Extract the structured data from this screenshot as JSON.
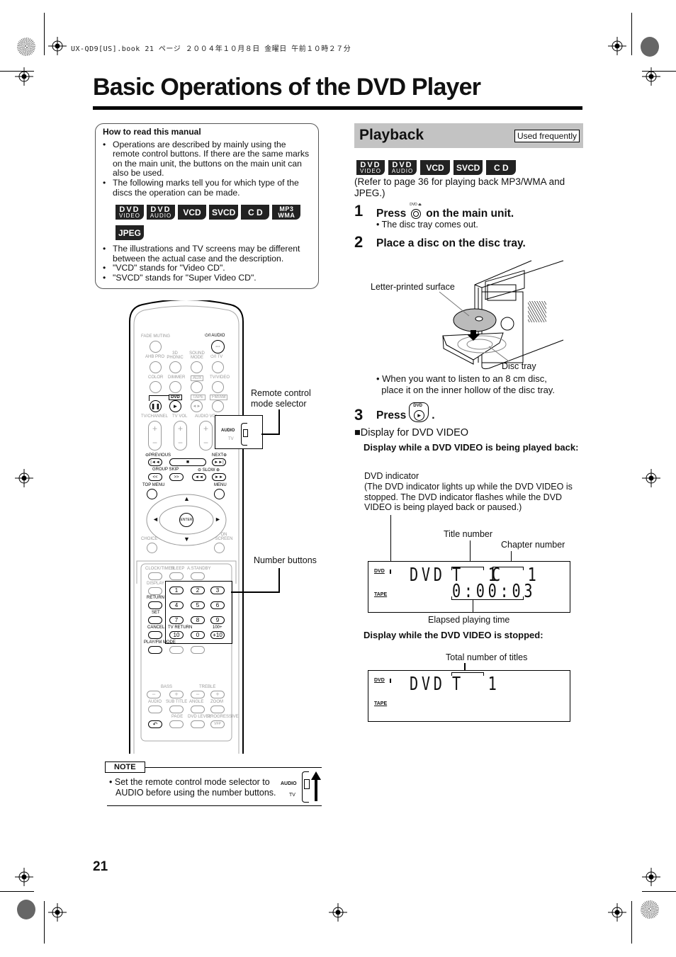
{
  "print_header": "UX-QD9[US].book  21 ページ  ２００４年１０月８日  金曜日  午前１０時２７分",
  "page_title": "Basic Operations of the DVD Player",
  "page_number": "21",
  "how_to_read": {
    "title": "How to read this manual",
    "bullets_top": [
      "Operations are described by mainly using the remote control buttons. If there are the same marks on the main unit, the buttons on the main unit can also be used.",
      "The following marks tell you for which type of the discs the operation can be made."
    ],
    "marks": [
      {
        "top": "DVD",
        "bottom": "VIDEO"
      },
      {
        "top": "DVD",
        "bottom": "AUDIO"
      },
      {
        "top": "VCD",
        "bottom": ""
      },
      {
        "top": "SVCD",
        "bottom": ""
      },
      {
        "top": "C D",
        "bottom": ""
      },
      {
        "top": "MP3",
        "bottom": "WMA"
      },
      {
        "top": "JPEG",
        "bottom": ""
      }
    ],
    "bullets_bottom": [
      "The illustrations and TV screens may be different between the actual case and the description.",
      "\"VCD\" stands for \"Video CD\".",
      "\"SVCD\" stands for \"Super Video CD\"."
    ]
  },
  "remote": {
    "callouts": {
      "mode_selector": "Remote control\nmode selector",
      "number_buttons": "Number buttons"
    },
    "labels": {
      "fade_muting": "FADE MUTING",
      "power_audio": "⏻/I AUDIO",
      "ahb_pro": "AHB PRO",
      "phonic": "3D PHONIC",
      "sound_mode": "SOUND MODE",
      "power_tv": "⏻/I TV",
      "color": "COLOR",
      "dimmer": "DIMMER",
      "aux": "AUX",
      "tv_video": "TV/VIDEO",
      "dvd": "DVD",
      "tape": "TAPE",
      "fm_am": "FM/AM",
      "tv_channel": "TV/CHANNEL",
      "tv_vol": "TV VOL",
      "audio_vol": "AUDIO VOL",
      "selector_audio": "AUDIO",
      "selector_tv": "TV",
      "previous": "⊖PREVIOUS",
      "next": "NEXT⊕",
      "group_skip": "GROUP SKIP",
      "slow": "⊖ SLOW ⊕",
      "top_menu": "TOP MENU",
      "menu": "MENU",
      "enter": "ENTER",
      "choice": "CHOICE",
      "on_screen": "ON SCREEN",
      "clock_timer": "CLOCK/TIMER",
      "sleep": "SLEEP",
      "a_standby": "A.STANDBY",
      "display": "DISPLAY",
      "return": "RETURN",
      "set": "SET",
      "cancel": "CANCEL",
      "tv_return": "TV RETURN",
      "hundred_plus": "100+",
      "play_fm_mode": "PLAY/FM MODE",
      "bass": "BASS",
      "treble": "TREBLE",
      "audio": "AUDIO",
      "sub_title": "SUB TITLE",
      "angle": "ANGLE",
      "zoom": "ZOOM",
      "page": "PAGE",
      "dvd_level": "DVD LEVEL",
      "progressive": "PROGRESSIVE",
      "vfp": "VFP"
    },
    "number_keys": [
      "1",
      "2",
      "3",
      "4",
      "5",
      "6",
      "7",
      "8",
      "9",
      "10",
      "0",
      "+10"
    ]
  },
  "note": {
    "tag": "NOTE",
    "text": "Set the remote control mode selector to AUDIO before using the number buttons.",
    "icon_audio": "AUDIO",
    "icon_tv": "TV"
  },
  "playback": {
    "title": "Playback",
    "badge": "Used frequently",
    "marks": [
      {
        "top": "DVD",
        "bottom": "VIDEO"
      },
      {
        "top": "DVD",
        "bottom": "AUDIO"
      },
      {
        "top": "VCD",
        "bottom": ""
      },
      {
        "top": "SVCD",
        "bottom": ""
      },
      {
        "top": "C D",
        "bottom": ""
      }
    ],
    "refer_note": "(Refer to page 36 for playing back MP3/WMA and JPEG.)",
    "steps": [
      {
        "num": "1",
        "pre": "Press",
        "icon_label": "DVD ⏏",
        "post": "on the main unit.",
        "sub": "• The disc tray comes out."
      },
      {
        "num": "2",
        "text": "Place a disc on the disc tray."
      },
      {
        "num": "3",
        "pre": "Press",
        "icon_label": "DVD",
        "post": "."
      }
    ],
    "illustration": {
      "letter_surface": "Letter-printed surface",
      "disc_tray": "Disc tray"
    },
    "tip": "• When you want to listen to an 8 cm disc,\n  place it on the inner hollow of the disc tray.",
    "display_heading": "■Display for DVD VIDEO",
    "playing_heading": "Display while a DVD VIDEO is being played back:",
    "dvd_indicator": "DVD indicator",
    "dvd_indicator_desc": "(The DVD indicator lights up while the DVD VIDEO is stopped. The DVD indicator flashes while the DVD VIDEO is being played back or paused.)",
    "title_number": "Title number",
    "chapter_number": "Chapter number",
    "elapsed_time": "Elapsed playing time",
    "display_playing": {
      "mode": "DVD",
      "title": "T  1",
      "chapter": "C  1",
      "time": "0:00:03",
      "ind_dvd": "DVD",
      "ind_tape": "TAPE"
    },
    "stopped_heading": "Display while the DVD VIDEO is stopped:",
    "total_titles": "Total number of titles",
    "display_stopped": {
      "mode": "DVD",
      "title": "T  1",
      "ind_dvd": "DVD",
      "ind_tape": "TAPE"
    }
  }
}
